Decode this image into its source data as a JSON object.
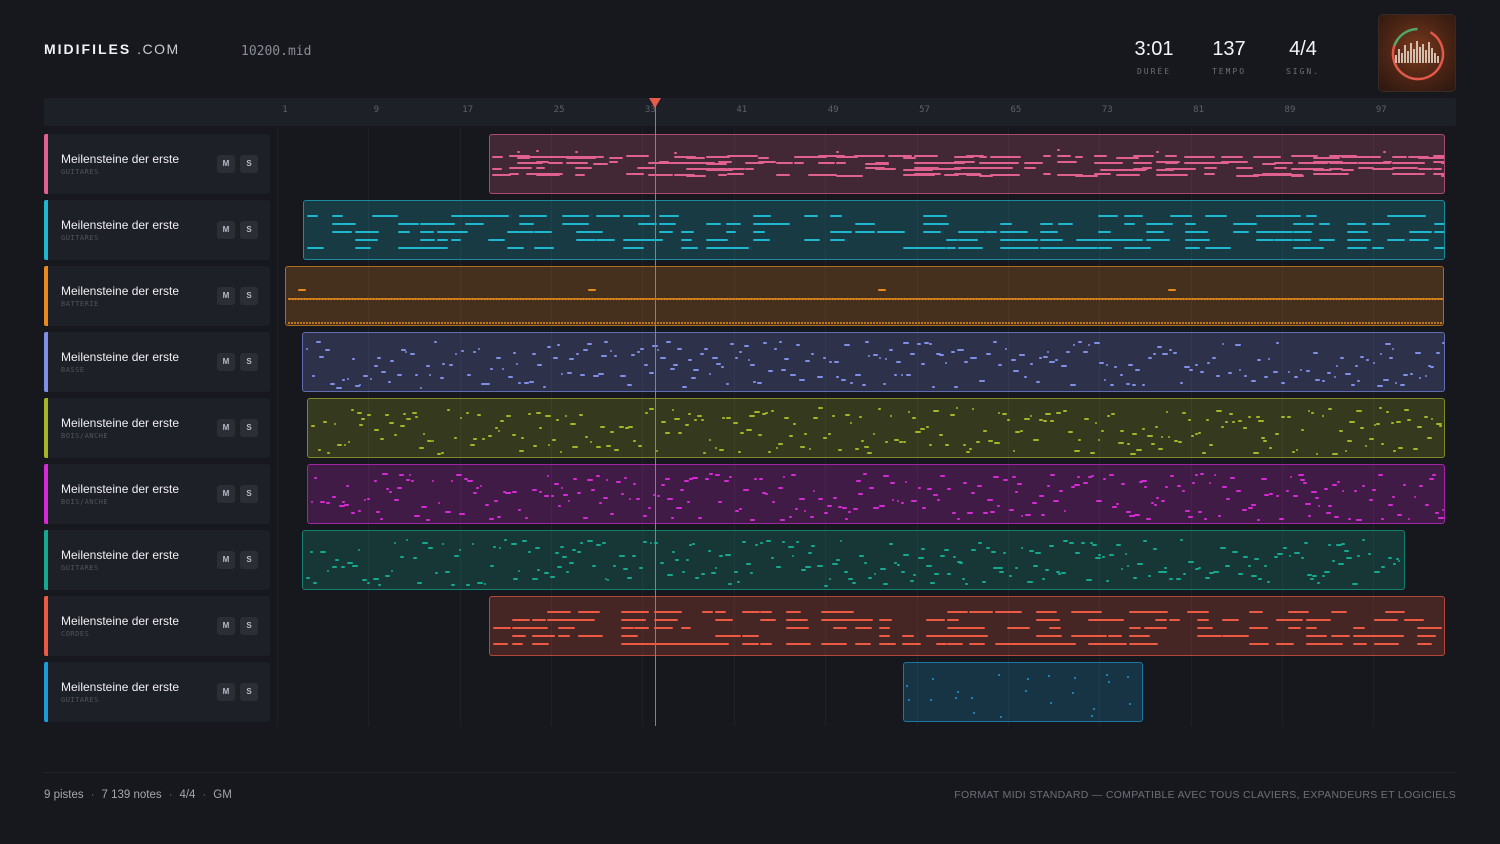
{
  "header": {
    "brand": "MIDIFILES",
    "tld": ".COM",
    "filename": "10200.mid",
    "stats": [
      {
        "value": "3:01",
        "label": "DURÉE"
      },
      {
        "value": "137",
        "label": "TEMPO"
      },
      {
        "value": "4/4",
        "label": "SIGN."
      }
    ]
  },
  "ruler": {
    "ticks": [
      "1",
      "9",
      "17",
      "25",
      "33",
      "41",
      "49",
      "57",
      "65",
      "73",
      "81",
      "89",
      "97"
    ],
    "total_bars": 102,
    "playhead_bar": 33
  },
  "buttons": {
    "mute": "M",
    "solo": "S"
  },
  "tracks": [
    {
      "name": "Meilensteine der erste",
      "category": "GUITARES",
      "color": "#e0608e",
      "clip_start_bar": 18.9,
      "clip_end_bar": 102.6,
      "pattern": "sustain"
    },
    {
      "name": "Meilensteine der erste",
      "category": "GUITARES",
      "color": "#1fb6cf",
      "clip_start_bar": 2.6,
      "clip_end_bar": 102.6,
      "pattern": "chords"
    },
    {
      "name": "Meilensteine der erste",
      "category": "BATTERIE",
      "color": "#e88a1e",
      "clip_start_bar": 1.0,
      "clip_end_bar": 102.5,
      "pattern": "drums"
    },
    {
      "name": "Meilensteine der erste",
      "category": "BASSE",
      "color": "#7f8fe8",
      "clip_start_bar": 2.5,
      "clip_end_bar": 102.6,
      "pattern": "melody"
    },
    {
      "name": "Meilensteine der erste",
      "category": "BOIS/ANCHE",
      "color": "#a6b428",
      "clip_start_bar": 2.9,
      "clip_end_bar": 102.6,
      "pattern": "melody"
    },
    {
      "name": "Meilensteine der erste",
      "category": "BOIS/ANCHE",
      "color": "#d62ad6",
      "clip_start_bar": 2.9,
      "clip_end_bar": 102.6,
      "pattern": "melody"
    },
    {
      "name": "Meilensteine der erste",
      "category": "GUITARES",
      "color": "#16a890",
      "clip_start_bar": 2.5,
      "clip_end_bar": 99.1,
      "pattern": "melody"
    },
    {
      "name": "Meilensteine der erste",
      "category": "CORDES",
      "color": "#ec5a44",
      "clip_start_bar": 18.9,
      "clip_end_bar": 102.6,
      "pattern": "chords"
    },
    {
      "name": "Meilensteine der erste",
      "category": "GUITARES",
      "color": "#1d9ad8",
      "clip_start_bar": 55.1,
      "clip_end_bar": 76.1,
      "pattern": "sparse"
    }
  ],
  "footer": {
    "tracks_count": "9 pistes",
    "notes_count": "7 139 notes",
    "signature": "4/4",
    "standard": "GM",
    "tagline": "FORMAT MIDI STANDARD — COMPATIBLE AVEC TOUS CLAVIERS, EXPANDEURS ET LOGICIELS"
  }
}
